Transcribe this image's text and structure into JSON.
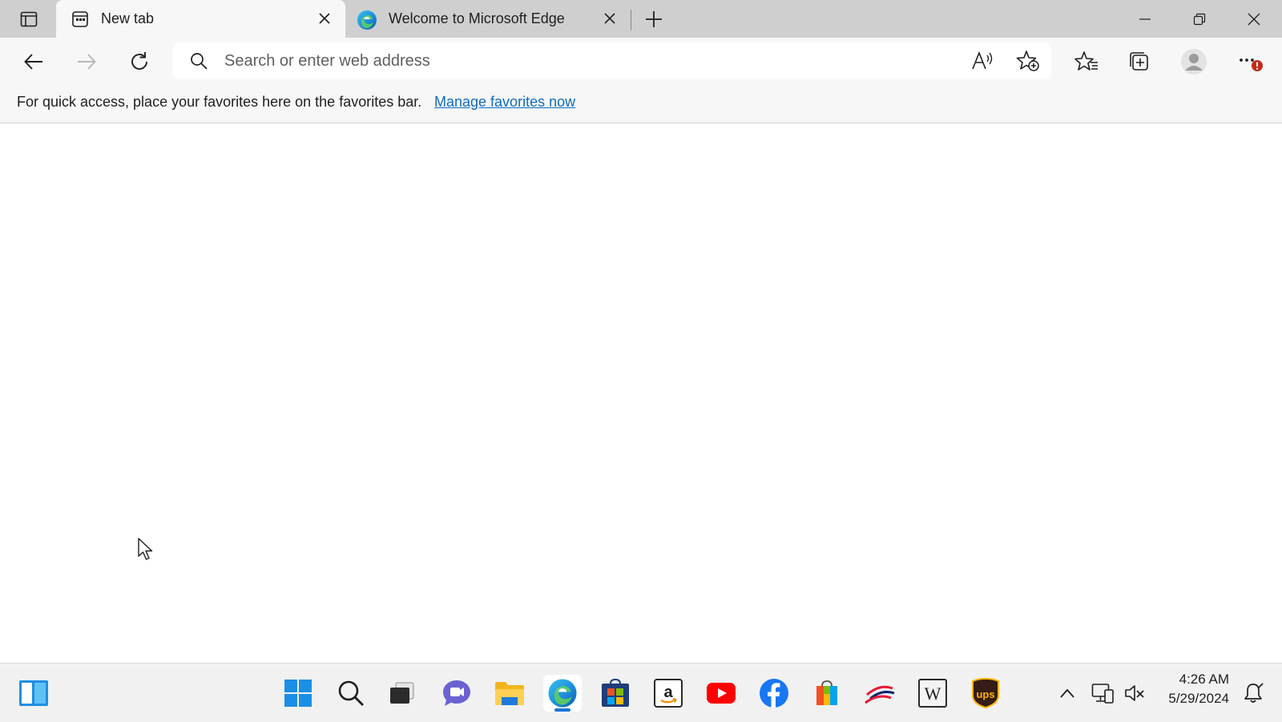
{
  "tabs": [
    {
      "label": "New tab",
      "active": true
    },
    {
      "label": "Welcome to Microsoft Edge",
      "active": false
    }
  ],
  "toolbar": {
    "address_placeholder": "Search or enter web address"
  },
  "favorites_bar": {
    "message": "For quick access, place your favorites here on the favorites bar.",
    "link": "Manage favorites now"
  },
  "taskbar": {
    "pinned": [
      "start-icon",
      "search-icon",
      "task-view-icon",
      "chat-icon",
      "file-explorer-icon",
      "edge-icon",
      "store-icon",
      "amazon-icon",
      "youtube-icon",
      "facebook-icon",
      "office-icon",
      "bank-icon",
      "wikipedia-icon",
      "ups-icon"
    ],
    "amazon_letter": "a",
    "wikipedia_letter": "W",
    "ups_text": "ups",
    "clock": {
      "time": "4:26 AM",
      "date": "5/29/2024"
    }
  },
  "colors": {
    "tab_strip": "#cfcfcf",
    "toolbar": "#f7f7f7",
    "link": "#0f6cbd",
    "notification_badge": "#c42b1c"
  }
}
